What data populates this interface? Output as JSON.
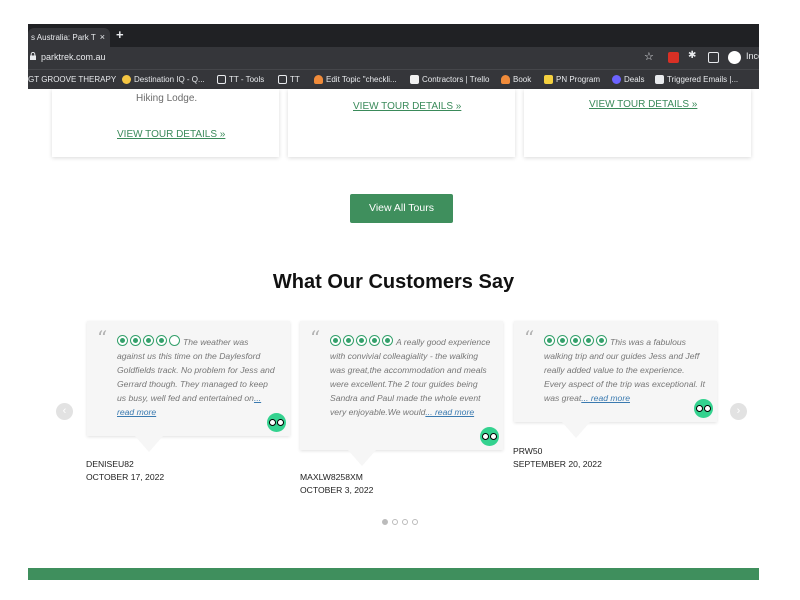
{
  "browser": {
    "tab_title": "s Australia: Park T",
    "tab_close": "×",
    "new_tab": "+",
    "url": "parktrek.com.au",
    "profile_label": "Inco",
    "bookmarks": [
      "GT  GROOVE THERAPY",
      "Destination IQ - Q...",
      "TT - Tools",
      "TT",
      "Edit Topic \"checkli...",
      "Contractors | Trello",
      "Book",
      "PN Program",
      "Deals",
      "Triggered Emails |..."
    ]
  },
  "tours": {
    "card1_text": "Hiking Lodge.",
    "view_details": "VIEW TOUR DETAILS »",
    "view_all": "View All Tours"
  },
  "testimonials": {
    "heading": "What Our Customers Say",
    "prev_arrow": "‹",
    "next_arrow": "›",
    "reviews": [
      {
        "rating": 4,
        "text": "The weather was against us this time on the Daylesford Goldfields track. No problem for Jess and Gerrard though. They managed to keep us busy, well fed and entertained on",
        "more": "... read more",
        "name": "DENISEU82",
        "date": "OCTOBER 17, 2022"
      },
      {
        "rating": 5,
        "text": "A really good experience with convivial colleagiality - the walking was great,the accommodation and meals were excellent.The 2 tour guides being Sandra and Paul made the whole event very enjoyable.We would",
        "more": "... read more",
        "name": "MAXLW8258XM",
        "date": "OCTOBER 3, 2022"
      },
      {
        "rating": 5,
        "text": "This was a fabulous walking trip and our guides Jess and Jeff really added value to the experience. Every aspect of the trip was exceptional. It was great",
        "more": "... read more",
        "name": "PRW50",
        "date": "SEPTEMBER 20, 2022"
      }
    ]
  },
  "colors": {
    "brand_green": "#3f8f5d",
    "rating_green": "#34a06b"
  }
}
